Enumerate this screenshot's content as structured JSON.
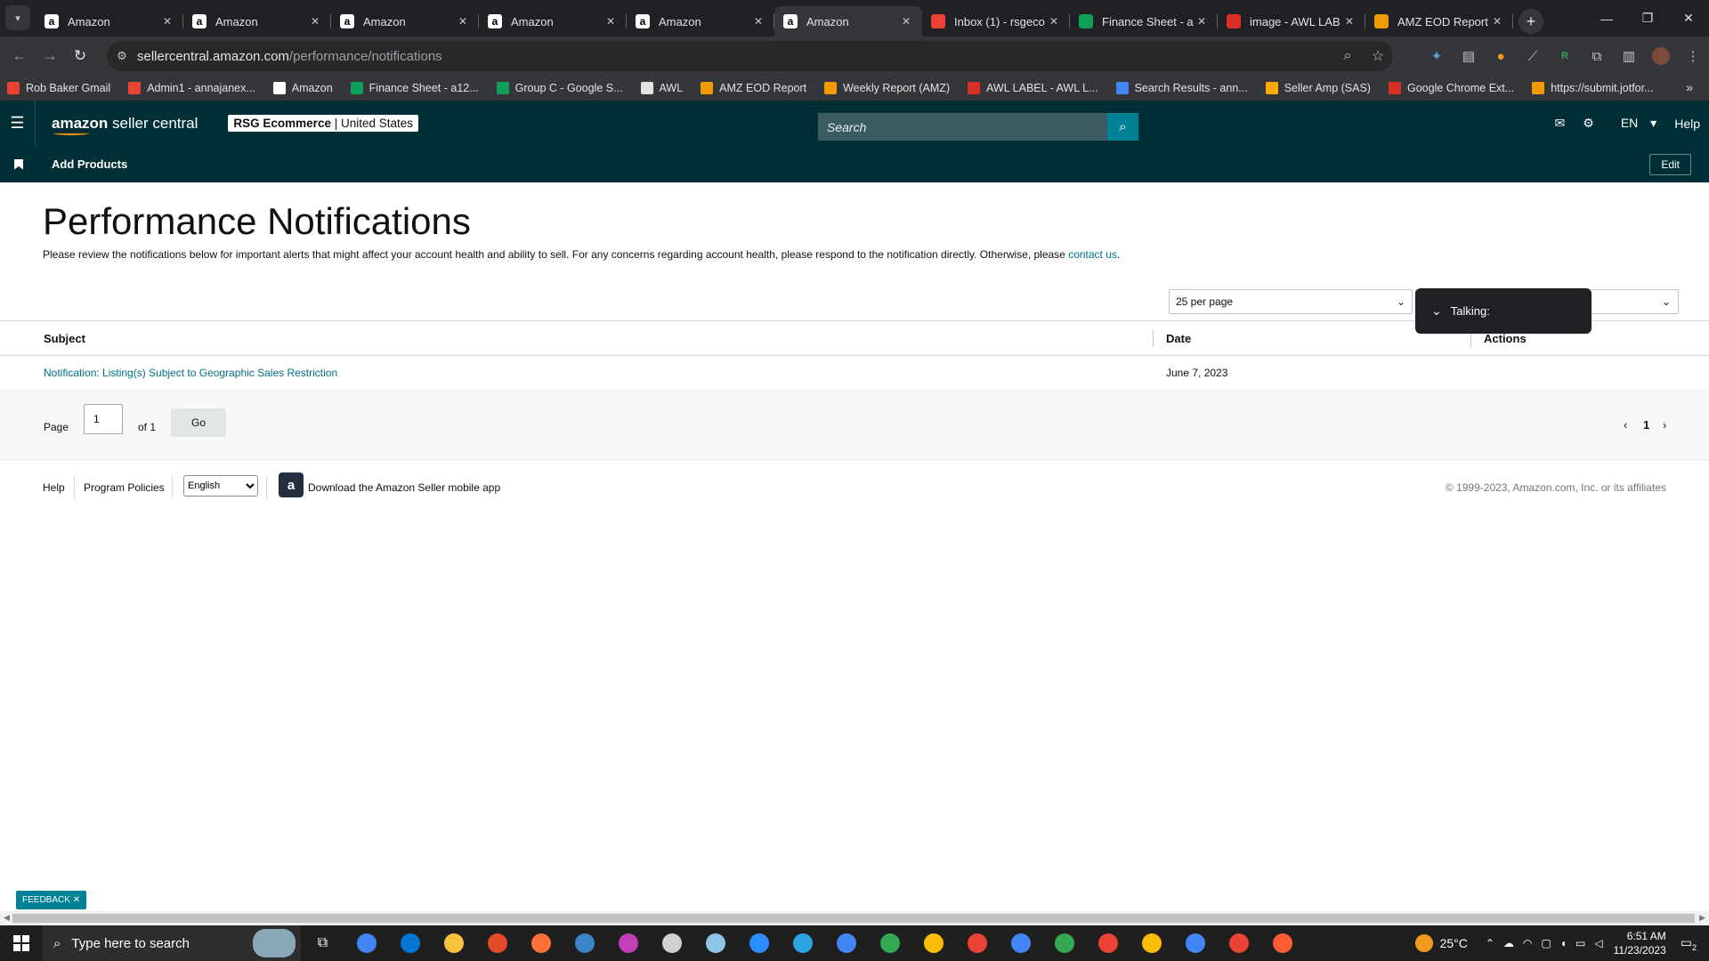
{
  "browser": {
    "tabs": [
      {
        "title": "Amazon",
        "icon": "amazon-icon",
        "active": false
      },
      {
        "title": "Amazon",
        "icon": "amazon-icon",
        "active": false
      },
      {
        "title": "Amazon",
        "icon": "amazon-icon",
        "active": false
      },
      {
        "title": "Amazon",
        "icon": "amazon-icon",
        "active": false
      },
      {
        "title": "Amazon",
        "icon": "amazon-icon",
        "active": false
      },
      {
        "title": "Amazon",
        "icon": "amazon-icon",
        "active": true
      },
      {
        "title": "Inbox (1) - rsgeco",
        "icon": "gmail-icon",
        "active": false
      },
      {
        "title": "Finance Sheet - a",
        "icon": "sheets-icon",
        "active": false
      },
      {
        "title": "image - AWL LAB",
        "icon": "awl-icon",
        "active": false
      },
      {
        "title": "AMZ EOD Report",
        "icon": "report-icon",
        "active": false
      }
    ],
    "url_host": "sellercentral.amazon.com",
    "url_path": "/performance/notifications",
    "bookmarks": [
      {
        "label": "Rob Baker Gmail",
        "color": "#ea4335"
      },
      {
        "label": "Admin1 - annajanex...",
        "color": "#ea4335"
      },
      {
        "label": "Amazon",
        "color": "#ffffff"
      },
      {
        "label": "Finance Sheet - a12...",
        "color": "#0f9d58"
      },
      {
        "label": "Group C - Google S...",
        "color": "#0f9d58"
      },
      {
        "label": "AWL",
        "color": "#e3e3e3"
      },
      {
        "label": "AMZ EOD Report",
        "color": "#f29900"
      },
      {
        "label": "Weekly Report (AMZ)",
        "color": "#f29900"
      },
      {
        "label": "AWL LABEL - AWL L...",
        "color": "#d93025"
      },
      {
        "label": "Search Results - ann...",
        "color": "#4285f4"
      },
      {
        "label": "Seller Amp (SAS)",
        "color": "#f9ab00"
      },
      {
        "label": "Google Chrome Ext...",
        "color": "#d93025"
      },
      {
        "label": "https://submit.jotfor...",
        "color": "#f29900"
      }
    ]
  },
  "header": {
    "logo_bold": "amazon",
    "logo_rest": " seller central",
    "account_bold": "RSG Ecommerce",
    "account_rest": " | United States",
    "search_placeholder": "Search",
    "language": "EN",
    "help": "Help"
  },
  "subnav": {
    "add_products": "Add Products",
    "edit": "Edit"
  },
  "main": {
    "title": "Performance Notifications",
    "description": "Please review the notifications below for important alerts that might affect your account health and ability to sell. For any concerns regarding account health, please respond to the notification directly. Otherwise, please ",
    "contact_link": "contact us",
    "description_end": ".",
    "per_page": "25 per page",
    "talking_popup": "Talking:",
    "columns": {
      "subject": "Subject",
      "date": "Date",
      "actions": "Actions"
    },
    "rows": [
      {
        "subject": "Notification: Listing(s) Subject to Geographic Sales Restriction",
        "date": "June 7, 2023"
      }
    ],
    "pager": {
      "page_label": "Page",
      "page_value": "1",
      "of_label": "of 1",
      "go": "Go",
      "current": "1"
    }
  },
  "footer": {
    "help": "Help",
    "program_policies": "Program Policies",
    "language_selected": "English",
    "download_app": "Download the Amazon Seller mobile app",
    "copyright": "© 1999-2023, Amazon.com, Inc. or its affiliates",
    "feedback": "FEEDBACK"
  },
  "taskbar": {
    "search_placeholder": "Type here to search",
    "temperature": "25°C",
    "time": "6:51 AM",
    "date": "11/23/2023",
    "notification_count": "2",
    "apps": [
      {
        "name": "chrome-icon",
        "color": "#4285f4"
      },
      {
        "name": "mail-icon",
        "color": "#0078d4"
      },
      {
        "name": "folder-icon",
        "color": "#f8c33c"
      },
      {
        "name": "app-icon",
        "color": "#e34c26"
      },
      {
        "name": "firefox-icon",
        "color": "#ff7139"
      },
      {
        "name": "calculator-icon",
        "color": "#3a86c8"
      },
      {
        "name": "app-icon",
        "color": "#c33fb8"
      },
      {
        "name": "app-icon",
        "color": "#d0d0d0"
      },
      {
        "name": "notes-icon",
        "color": "#8ec6e8"
      },
      {
        "name": "zoom-icon",
        "color": "#2d8cff"
      },
      {
        "name": "telegram-icon",
        "color": "#2aa3df"
      },
      {
        "name": "chrome-icon",
        "color": "#4285f4"
      },
      {
        "name": "chrome-icon",
        "color": "#34a853"
      },
      {
        "name": "chrome-icon",
        "color": "#fbbc05"
      },
      {
        "name": "chrome-icon",
        "color": "#ea4335"
      },
      {
        "name": "chrome-icon",
        "color": "#4285f4"
      },
      {
        "name": "chrome-icon",
        "color": "#34a853"
      },
      {
        "name": "chrome-icon",
        "color": "#ea4335"
      },
      {
        "name": "chrome-icon",
        "color": "#fbbc05"
      },
      {
        "name": "chrome-icon",
        "color": "#4285f4"
      },
      {
        "name": "chrome-icon",
        "color": "#ea4335"
      },
      {
        "name": "app-icon",
        "color": "#ff5c35"
      }
    ]
  }
}
